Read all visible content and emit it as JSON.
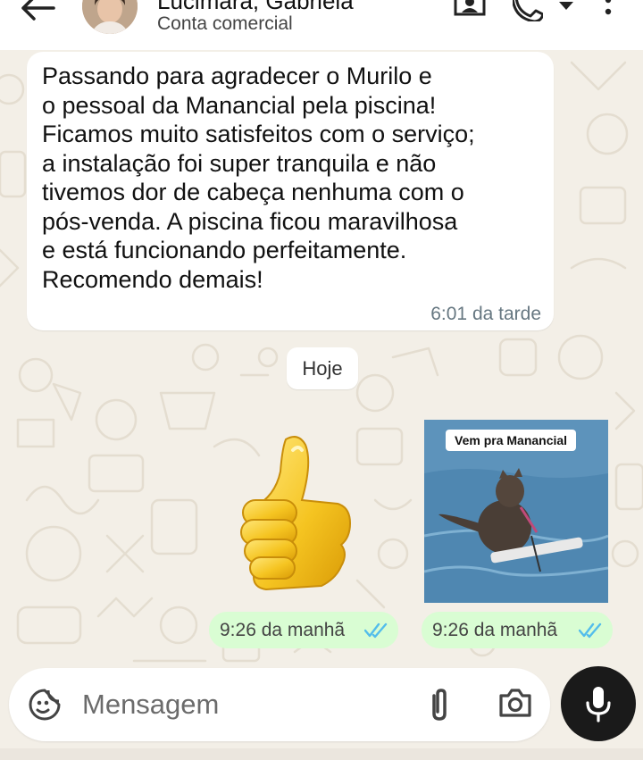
{
  "header": {
    "contact_name": "Lucimara, Gabriela",
    "contact_subtitle": "Conta comercial",
    "icons": [
      "back-arrow-icon",
      "contact-card-icon",
      "phone-icon",
      "dropdown-arrow-icon",
      "more-vert-icon"
    ]
  },
  "messages": {
    "incoming": {
      "text": "Passando para agradecer o Murilo e\no pessoal da Manancial pela piscina!\nFicamos muito satisfeitos com o serviço;\na instalação foi super tranquila e não\ntivemos dor de cabeça nenhuma com o\npós-venda. A piscina ficou maravilhosa\ne está funcionando perfeitamente.\nRecomendo demais!",
      "time": "6:01 da tarde"
    },
    "date_separator": "Hoje",
    "sticker": {
      "icon": "thumbs-up-icon",
      "time": "9:26 da manhã"
    },
    "image": {
      "caption": "Vem pra Manancial",
      "time": "9:26 da manhã"
    }
  },
  "composer": {
    "placeholder": "Mensagem",
    "icons": [
      "emoji-sticker-icon",
      "paperclip-icon",
      "camera-icon",
      "mic-icon"
    ]
  },
  "colors": {
    "chat_background": "#f3efe7",
    "incoming_bubble": "#ffffff",
    "outgoing_meta": "#d9fdd3",
    "read_ticks": "#53bdeb",
    "mic_button": "#1a1a1a"
  }
}
